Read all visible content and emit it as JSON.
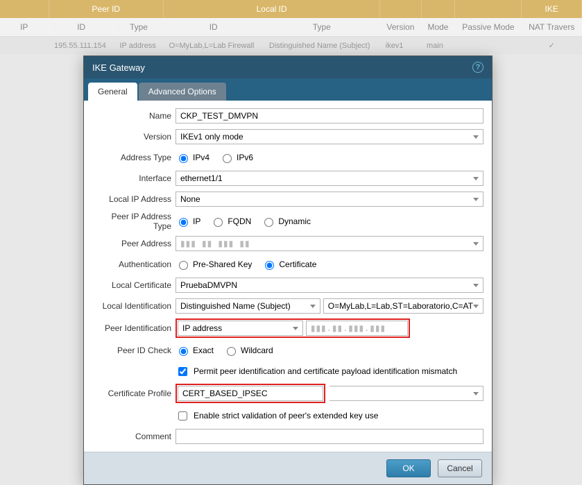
{
  "bg": {
    "top_headers": [
      "",
      "Peer ID",
      "Local ID",
      "",
      "",
      "",
      "IKE"
    ],
    "sub_headers": [
      "IP",
      "ID",
      "Type",
      "ID",
      "Type",
      "Version",
      "Mode",
      "Passive Mode",
      "NAT Travers"
    ],
    "row": {
      "ip": "",
      "id": "195.55.111.154",
      "type": "IP address",
      "lid": "O=MyLab,L=Lab Firewall",
      "ltype": "Distinguished Name (Subject)",
      "version": "ikev1",
      "mode": "main",
      "passive": "",
      "nat": "✓"
    }
  },
  "dialog": {
    "title": "IKE Gateway",
    "tabs": {
      "general": "General",
      "advanced": "Advanced Options"
    },
    "labels": {
      "name": "Name",
      "version": "Version",
      "addrtype": "Address Type",
      "interface": "Interface",
      "localip": "Local IP Address",
      "peeriptype": "Peer IP Address Type",
      "peeraddr": "Peer Address",
      "auth": "Authentication",
      "localcert": "Local Certificate",
      "localid": "Local Identification",
      "peerid": "Peer Identification",
      "peeridcheck": "Peer ID Check",
      "certprofile": "Certificate Profile",
      "comment": "Comment"
    },
    "values": {
      "name": "CKP_TEST_DMVPN",
      "version": "IKEv1 only mode",
      "interface": "ethernet1/1",
      "localip": "None",
      "peeraddr": "▮▮▮ ▮▮ ▮▮▮ ▮▮",
      "localcert": "PruebaDMVPN",
      "localid_type": "Distinguished Name (Subject)",
      "localid_val": "O=MyLab,L=Lab,ST=Laboratorio,C=AT",
      "peerid_type": "IP address",
      "peerid_val": "▮▮▮.▮▮.▮▮▮.▮▮▮",
      "certprofile": "CERT_BASED_IPSEC",
      "comment": ""
    },
    "radios": {
      "addrtype": {
        "ipv4": "IPv4",
        "ipv6": "IPv6"
      },
      "peeriptype": {
        "ip": "IP",
        "fqdn": "FQDN",
        "dynamic": "Dynamic"
      },
      "auth": {
        "psk": "Pre-Shared Key",
        "cert": "Certificate"
      },
      "peeridcheck": {
        "exact": "Exact",
        "wildcard": "Wildcard"
      }
    },
    "checks": {
      "permit": "Permit peer identification and certificate payload identification mismatch",
      "strict": "Enable strict validation of peer's extended key use"
    },
    "buttons": {
      "ok": "OK",
      "cancel": "Cancel"
    }
  }
}
